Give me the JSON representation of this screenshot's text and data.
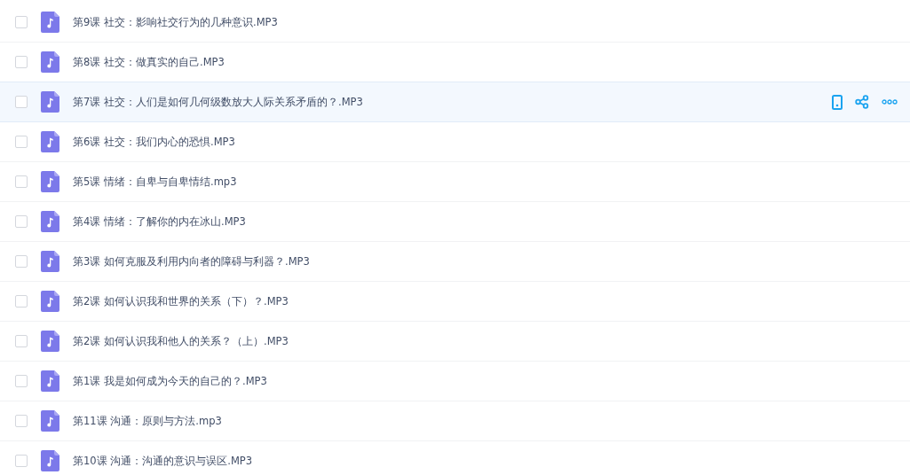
{
  "files": [
    {
      "name": "第9课 社交：影响社交行为的几种意识.MP3",
      "checked": false,
      "hovered": false
    },
    {
      "name": "第8课 社交：做真实的自己.MP3",
      "checked": false,
      "hovered": false
    },
    {
      "name": "第7课 社交：人们是如何几何级数放大人际关系矛盾的？.MP3",
      "checked": false,
      "hovered": true
    },
    {
      "name": "第6课 社交：我们内心的恐惧.MP3",
      "checked": false,
      "hovered": false
    },
    {
      "name": "第5课 情绪：自卑与自卑情结.mp3",
      "checked": false,
      "hovered": false
    },
    {
      "name": "第4课 情绪：了解你的内在冰山.MP3",
      "checked": false,
      "hovered": false
    },
    {
      "name": "第3课 如何克服及利用内向者的障碍与利器？.MP3",
      "checked": false,
      "hovered": false
    },
    {
      "name": "第2课 如何认识我和世界的关系（下）？.MP3",
      "checked": false,
      "hovered": false
    },
    {
      "name": "第2课 如何认识我和他人的关系？（上）.MP3",
      "checked": false,
      "hovered": false
    },
    {
      "name": "第1课 我是如何成为今天的自己的？.MP3",
      "checked": false,
      "hovered": false
    },
    {
      "name": "第11课 沟通：原则与方法.mp3",
      "checked": false,
      "hovered": false
    },
    {
      "name": "第10课 沟通：沟通的意识与误区.MP3",
      "checked": false,
      "hovered": false
    }
  ]
}
